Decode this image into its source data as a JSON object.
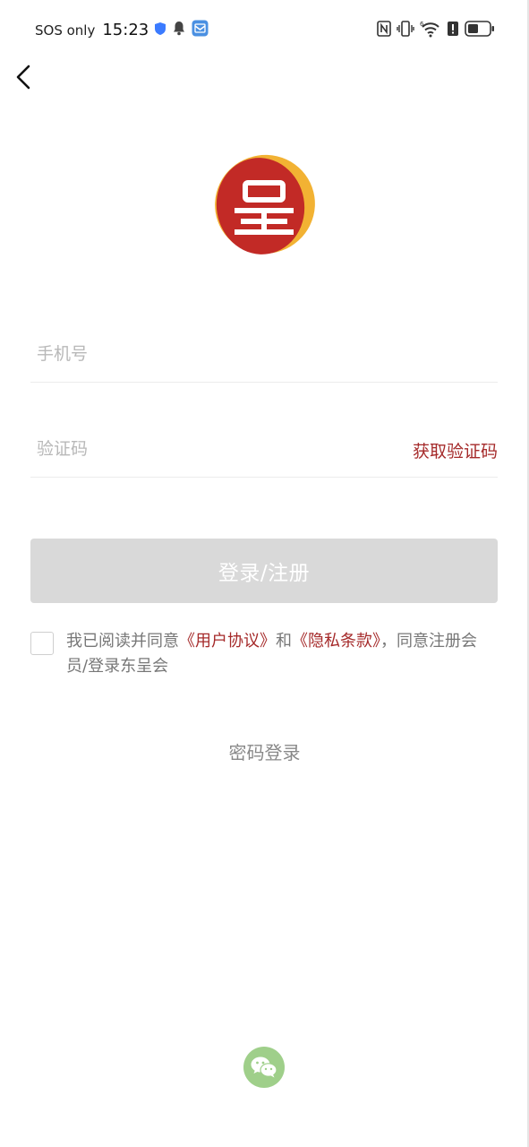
{
  "status_bar": {
    "carrier": "SOS only",
    "time": "15:23",
    "icons_left": [
      "shield-icon",
      "bell-icon",
      "app-notification-icon"
    ],
    "icons_right": [
      "nfc-icon",
      "vibrate-icon",
      "wifi-icon",
      "alert-icon",
      "battery-icon"
    ],
    "wifi_badge": "6"
  },
  "navigation": {
    "back_icon": "chevron-left-icon"
  },
  "logo": {
    "character": "呈",
    "colors": {
      "outer": "#f2b233",
      "inner": "#c22a26",
      "glyph": "#ffffff"
    }
  },
  "form": {
    "phone_placeholder": "手机号",
    "code_placeholder": "验证码",
    "get_code_label": "获取验证码",
    "submit_label": "登录/注册"
  },
  "agreement": {
    "prefix": "我已阅读并同意",
    "user_agreement": "《用户协议》",
    "and": "和",
    "privacy_policy": "《隐私条款》",
    "suffix": "，同意注册会员/登录东呈会",
    "checked": false
  },
  "alt_login": {
    "password_login_label": "密码登录",
    "wechat_icon": "wechat-icon"
  },
  "colors": {
    "accent": "#a52a2a",
    "button_disabled": "#d9d9d9",
    "wechat": "#9fcf8a"
  }
}
